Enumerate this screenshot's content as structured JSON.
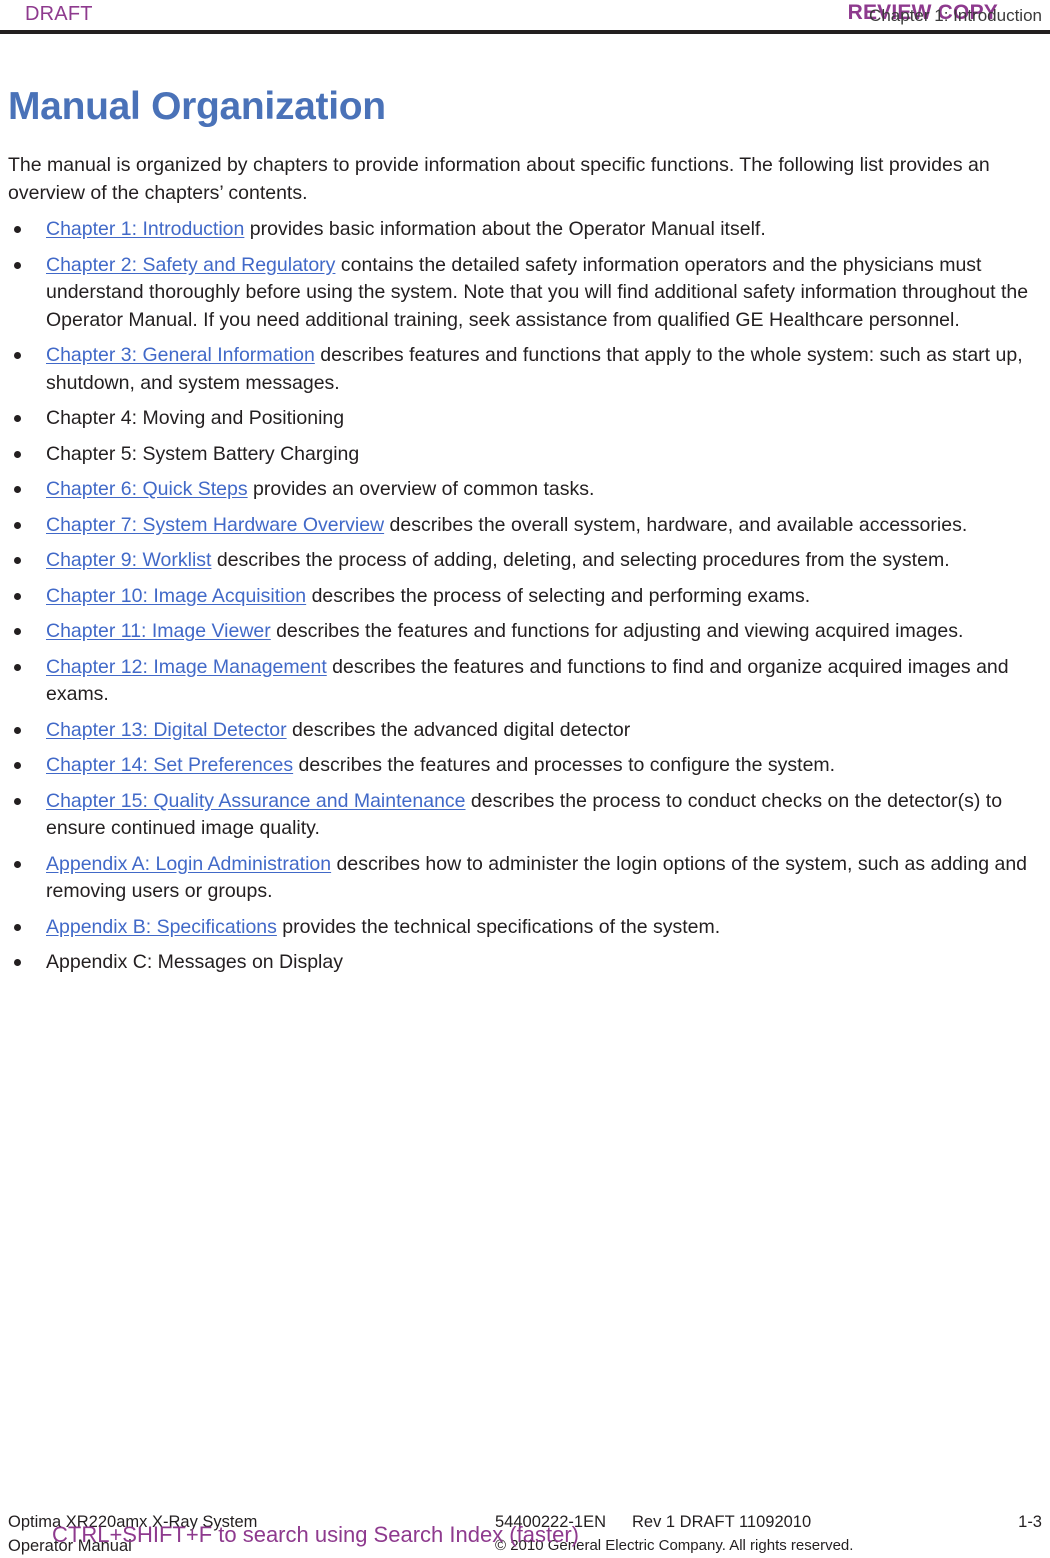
{
  "header": {
    "draft_label": "DRAFT",
    "review_copy_label": "REVIEW COPY",
    "chapter_label": "Chapter 1: Introduction"
  },
  "colors": {
    "title_blue": "#4a72b8",
    "link_blue": "#4169c8",
    "watermark_purple": "#8e3a8e",
    "body_black": "#231f20"
  },
  "main": {
    "title": "Manual Organization",
    "intro": "The manual is organized by chapters to provide information about specific functions. The following list provides an overview of the chapters’ contents.",
    "items": [
      {
        "link": "Chapter 1: Introduction",
        "is_link": true,
        "text": " provides basic information about the Operator Manual itself."
      },
      {
        "link": "Chapter 2: Safety and Regulatory",
        "is_link": true,
        "text": " contains the detailed safety information operators and the physicians must understand thoroughly before using the system. Note that you will find additional safety information throughout the Operator Manual. If you need additional training, seek assistance from qualified GE Healthcare personnel."
      },
      {
        "link": "Chapter 3: General Information",
        "is_link": true,
        "text": " describes features and functions that apply to the whole system: such as start up, shutdown, and system messages."
      },
      {
        "link": "Chapter 4: Moving and Positioning",
        "is_link": false,
        "text": ""
      },
      {
        "link": "Chapter 5: System Battery Charging",
        "is_link": false,
        "text": ""
      },
      {
        "link": "Chapter 6: Quick Steps",
        "is_link": true,
        "text": " provides an overview of common tasks."
      },
      {
        "link": "Chapter 7: System Hardware Overview",
        "is_link": true,
        "text": " describes the overall system, hardware, and available accessories."
      },
      {
        "link": "Chapter 9: Worklist",
        "is_link": true,
        "text": " describes the process of adding, deleting, and selecting procedures from the system."
      },
      {
        "link": "Chapter 10: Image Acquisition",
        "is_link": true,
        "text": " describes the process of selecting and performing exams."
      },
      {
        "link": "Chapter 11: Image Viewer",
        "is_link": true,
        "text": " describes the features and functions for adjusting and viewing acquired images."
      },
      {
        "link": "Chapter 12: Image Management",
        "is_link": true,
        "text": " describes the features and functions to find and organize acquired images and exams."
      },
      {
        "link": "Chapter 13: Digital Detector",
        "is_link": true,
        "text": " describes the advanced digital detector"
      },
      {
        "link": "Chapter 14: Set Preferences",
        "is_link": true,
        "text": " describes the features and processes to configure the system."
      },
      {
        "link": "Chapter 15: Quality Assurance and Maintenance",
        "is_link": true,
        "text": " describes the process to conduct checks on the detector(s) to ensure continued image quality."
      },
      {
        "link": "Appendix A: Login Administration",
        "is_link": true,
        "text": " describes how to administer the login options of the system, such as adding and removing users or groups."
      },
      {
        "link": "Appendix B: Specifications",
        "is_link": true,
        "text": " provides the technical specifications of the system."
      },
      {
        "link": "Appendix C: Messages on Display",
        "is_link": false,
        "text": ""
      }
    ]
  },
  "footer": {
    "system_name": "Optima XR220amx X-Ray System",
    "manual_name": "Operator Manual",
    "doc_number": "54400222-1EN",
    "revision": "Rev 1 DRAFT 11092010",
    "copyright": "© 2010 General Electric Company. All rights reserved.",
    "page_number": "1-3",
    "watermark": "CTRL+SHIFT+F to search using Search Index (faster)"
  }
}
